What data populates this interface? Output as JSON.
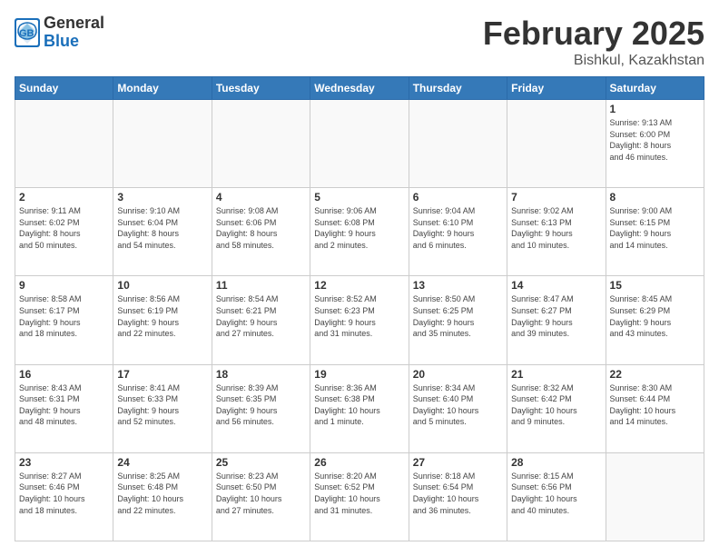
{
  "header": {
    "logo_general": "General",
    "logo_blue": "Blue",
    "title": "February 2025",
    "subtitle": "Bishkul, Kazakhstan"
  },
  "weekdays": [
    "Sunday",
    "Monday",
    "Tuesday",
    "Wednesday",
    "Thursday",
    "Friday",
    "Saturday"
  ],
  "weeks": [
    [
      {
        "day": "",
        "info": ""
      },
      {
        "day": "",
        "info": ""
      },
      {
        "day": "",
        "info": ""
      },
      {
        "day": "",
        "info": ""
      },
      {
        "day": "",
        "info": ""
      },
      {
        "day": "",
        "info": ""
      },
      {
        "day": "1",
        "info": "Sunrise: 9:13 AM\nSunset: 6:00 PM\nDaylight: 8 hours\nand 46 minutes."
      }
    ],
    [
      {
        "day": "2",
        "info": "Sunrise: 9:11 AM\nSunset: 6:02 PM\nDaylight: 8 hours\nand 50 minutes."
      },
      {
        "day": "3",
        "info": "Sunrise: 9:10 AM\nSunset: 6:04 PM\nDaylight: 8 hours\nand 54 minutes."
      },
      {
        "day": "4",
        "info": "Sunrise: 9:08 AM\nSunset: 6:06 PM\nDaylight: 8 hours\nand 58 minutes."
      },
      {
        "day": "5",
        "info": "Sunrise: 9:06 AM\nSunset: 6:08 PM\nDaylight: 9 hours\nand 2 minutes."
      },
      {
        "day": "6",
        "info": "Sunrise: 9:04 AM\nSunset: 6:10 PM\nDaylight: 9 hours\nand 6 minutes."
      },
      {
        "day": "7",
        "info": "Sunrise: 9:02 AM\nSunset: 6:13 PM\nDaylight: 9 hours\nand 10 minutes."
      },
      {
        "day": "8",
        "info": "Sunrise: 9:00 AM\nSunset: 6:15 PM\nDaylight: 9 hours\nand 14 minutes."
      }
    ],
    [
      {
        "day": "9",
        "info": "Sunrise: 8:58 AM\nSunset: 6:17 PM\nDaylight: 9 hours\nand 18 minutes."
      },
      {
        "day": "10",
        "info": "Sunrise: 8:56 AM\nSunset: 6:19 PM\nDaylight: 9 hours\nand 22 minutes."
      },
      {
        "day": "11",
        "info": "Sunrise: 8:54 AM\nSunset: 6:21 PM\nDaylight: 9 hours\nand 27 minutes."
      },
      {
        "day": "12",
        "info": "Sunrise: 8:52 AM\nSunset: 6:23 PM\nDaylight: 9 hours\nand 31 minutes."
      },
      {
        "day": "13",
        "info": "Sunrise: 8:50 AM\nSunset: 6:25 PM\nDaylight: 9 hours\nand 35 minutes."
      },
      {
        "day": "14",
        "info": "Sunrise: 8:47 AM\nSunset: 6:27 PM\nDaylight: 9 hours\nand 39 minutes."
      },
      {
        "day": "15",
        "info": "Sunrise: 8:45 AM\nSunset: 6:29 PM\nDaylight: 9 hours\nand 43 minutes."
      }
    ],
    [
      {
        "day": "16",
        "info": "Sunrise: 8:43 AM\nSunset: 6:31 PM\nDaylight: 9 hours\nand 48 minutes."
      },
      {
        "day": "17",
        "info": "Sunrise: 8:41 AM\nSunset: 6:33 PM\nDaylight: 9 hours\nand 52 minutes."
      },
      {
        "day": "18",
        "info": "Sunrise: 8:39 AM\nSunset: 6:35 PM\nDaylight: 9 hours\nand 56 minutes."
      },
      {
        "day": "19",
        "info": "Sunrise: 8:36 AM\nSunset: 6:38 PM\nDaylight: 10 hours\nand 1 minute."
      },
      {
        "day": "20",
        "info": "Sunrise: 8:34 AM\nSunset: 6:40 PM\nDaylight: 10 hours\nand 5 minutes."
      },
      {
        "day": "21",
        "info": "Sunrise: 8:32 AM\nSunset: 6:42 PM\nDaylight: 10 hours\nand 9 minutes."
      },
      {
        "day": "22",
        "info": "Sunrise: 8:30 AM\nSunset: 6:44 PM\nDaylight: 10 hours\nand 14 minutes."
      }
    ],
    [
      {
        "day": "23",
        "info": "Sunrise: 8:27 AM\nSunset: 6:46 PM\nDaylight: 10 hours\nand 18 minutes."
      },
      {
        "day": "24",
        "info": "Sunrise: 8:25 AM\nSunset: 6:48 PM\nDaylight: 10 hours\nand 22 minutes."
      },
      {
        "day": "25",
        "info": "Sunrise: 8:23 AM\nSunset: 6:50 PM\nDaylight: 10 hours\nand 27 minutes."
      },
      {
        "day": "26",
        "info": "Sunrise: 8:20 AM\nSunset: 6:52 PM\nDaylight: 10 hours\nand 31 minutes."
      },
      {
        "day": "27",
        "info": "Sunrise: 8:18 AM\nSunset: 6:54 PM\nDaylight: 10 hours\nand 36 minutes."
      },
      {
        "day": "28",
        "info": "Sunrise: 8:15 AM\nSunset: 6:56 PM\nDaylight: 10 hours\nand 40 minutes."
      },
      {
        "day": "",
        "info": ""
      }
    ]
  ]
}
